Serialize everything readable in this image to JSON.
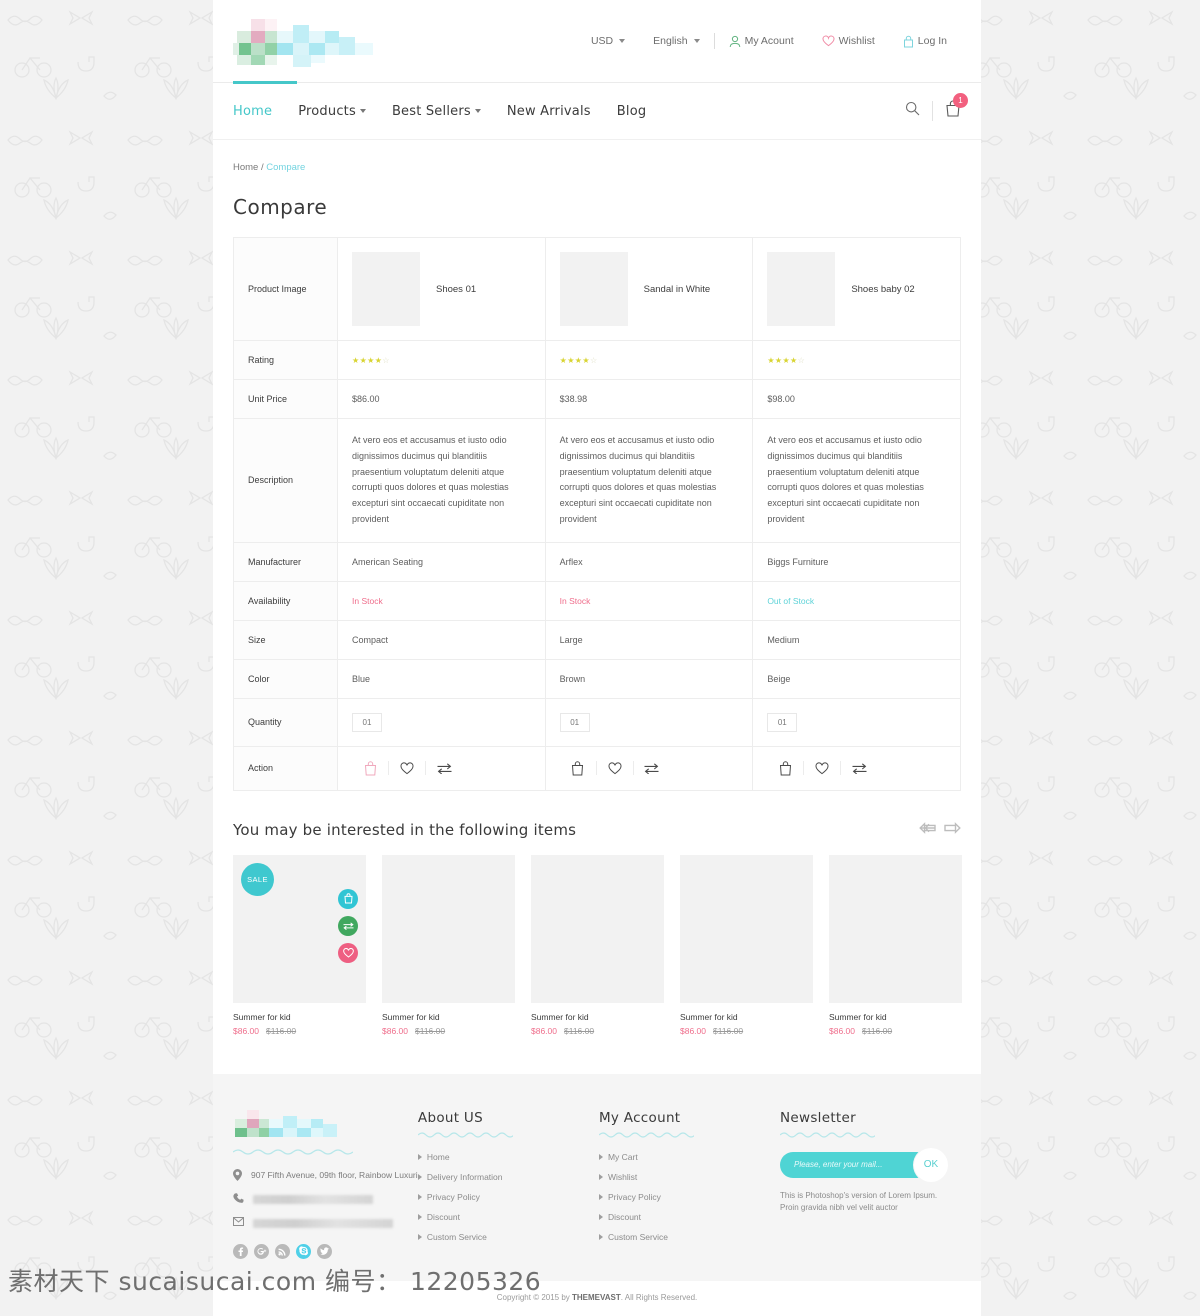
{
  "topbar": {
    "currency": "USD",
    "language": "English",
    "account": "My Acount",
    "wishlist": "Wishlist",
    "login": "Log In"
  },
  "nav": {
    "items": [
      {
        "label": "Home",
        "active": true,
        "caret": false
      },
      {
        "label": "Products",
        "active": false,
        "caret": true
      },
      {
        "label": "Best Sellers",
        "active": false,
        "caret": true
      },
      {
        "label": "New Arrivals",
        "active": false,
        "caret": false
      },
      {
        "label": "Blog",
        "active": false,
        "caret": false
      }
    ],
    "cart_count": "1"
  },
  "breadcrumb": {
    "home": "Home",
    "separator": "/",
    "current": "Compare"
  },
  "page_title": "Compare",
  "compare": {
    "row_labels": [
      "Product Image",
      "Rating",
      "Unit Price",
      "Description",
      "Manufacturer",
      "Availability",
      "Size",
      "Color",
      "Quantity",
      "Action"
    ],
    "products": [
      {
        "name": "Shoes 01",
        "rating_filled": 4,
        "rating_total": 5,
        "unit_price": "$86.00",
        "description": "At vero eos et accusamus et iusto odio dignissimos ducimus qui blanditiis praesentium voluptatum deleniti atque corrupti quos dolores et quas molestias excepturi sint occaecati cupiditate non provident",
        "manufacturer": "American Seating",
        "availability": "In Stock",
        "availability_state": "in",
        "size": "Compact",
        "color": "Blue",
        "quantity": "01",
        "cart_active": true
      },
      {
        "name": "Sandal in White",
        "rating_filled": 4,
        "rating_total": 5,
        "unit_price": "$38.98",
        "description": "At vero eos et accusamus et iusto odio dignissimos ducimus qui blanditiis praesentium voluptatum deleniti atque corrupti quos dolores et quas molestias excepturi sint occaecati cupiditate non provident",
        "manufacturer": "Arflex",
        "availability": "In Stock",
        "availability_state": "in",
        "size": "Large",
        "color": "Brown",
        "quantity": "01",
        "cart_active": false
      },
      {
        "name": "Shoes baby 02",
        "rating_filled": 4,
        "rating_total": 5,
        "unit_price": "$98.00",
        "description": "At vero eos et accusamus et iusto odio dignissimos ducimus qui blanditiis praesentium voluptatum deleniti atque corrupti quos dolores et quas molestias excepturi sint occaecati cupiditate non provident",
        "manufacturer": "Biggs Furniture",
        "availability": "Out of Stock",
        "availability_state": "out",
        "size": "Medium",
        "color": "Beige",
        "quantity": "01",
        "cart_active": false
      }
    ]
  },
  "related": {
    "title": "You may be interested in the following items",
    "items": [
      {
        "name": "Summer for kid",
        "price_new": "$86.00",
        "price_old": "$116.00",
        "sale_badge": "SALE",
        "hovered": true
      },
      {
        "name": "Summer for kid",
        "price_new": "$86.00",
        "price_old": "$116.00",
        "sale_badge": "",
        "hovered": false
      },
      {
        "name": "Summer for kid",
        "price_new": "$86.00",
        "price_old": "$116.00",
        "sale_badge": "",
        "hovered": false
      },
      {
        "name": "Summer for kid",
        "price_new": "$86.00",
        "price_old": "$116.00",
        "sale_badge": "",
        "hovered": false
      },
      {
        "name": "Summer for kid",
        "price_new": "$86.00",
        "price_old": "$116.00",
        "sale_badge": "",
        "hovered": false
      }
    ]
  },
  "footer": {
    "address": "907 Fifth Avenue, 09th floor, Rainbow Luxuri",
    "about": {
      "title": "About US",
      "links": [
        "Home",
        "Delivery Information",
        "Privacy Policy",
        "Discount",
        "Custom Service"
      ]
    },
    "account": {
      "title": "My Account",
      "links": [
        "My Cart",
        "Wishlist",
        "Privacy Policy",
        "Discount",
        "Custom Service"
      ]
    },
    "newsletter": {
      "title": "Newsletter",
      "placeholder": "Please, enter your mail...",
      "value": "",
      "ok_label": "OK",
      "note": "This is Photoshop's version  of Lorem Ipsum. Proin gravida nibh vel velit auctor"
    },
    "social": [
      "facebook-icon",
      "google-plus-icon",
      "rss-icon",
      "skype-icon",
      "twitter-icon"
    ]
  },
  "copyright": {
    "prefix": "Copyright © 2015 by ",
    "brand": "THEMEVAST",
    "suffix": ". All Rights Reserved."
  },
  "watermark": "素材天下 sucaisucai.com  编号： 12205326",
  "colors": {
    "accent_teal": "#45c7c9",
    "accent_pink": "#ef6e8c",
    "green": "#41a85f",
    "star_yellow": "#d8d431"
  }
}
